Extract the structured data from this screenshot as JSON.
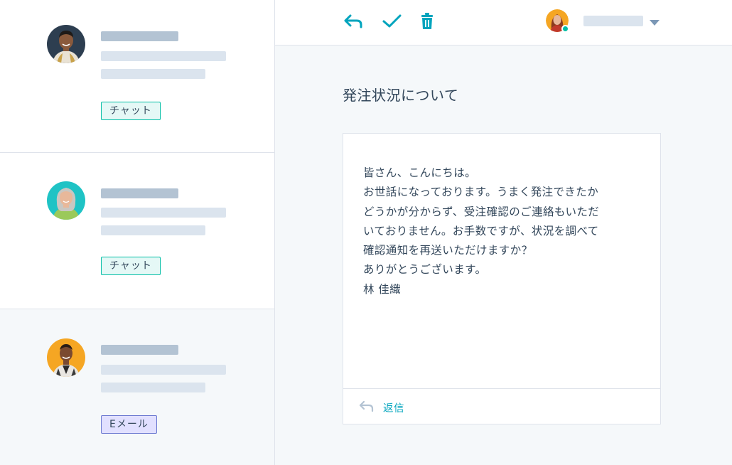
{
  "conversations": [
    {
      "channel_tag": "チャット",
      "channel_type": "chat",
      "avatar_colors": {
        "bg": "#2d3e50",
        "skin": "#8a5a3c",
        "hair": "#1f1a17",
        "shirt": "#e9e2d4"
      }
    },
    {
      "channel_tag": "チャット",
      "channel_type": "chat",
      "avatar_colors": {
        "bg": "#1fc3c5",
        "skin": "#e8b89a",
        "hair": "#c9c7c2",
        "shirt": "#9bc95a"
      }
    },
    {
      "channel_tag": "Eメール",
      "channel_type": "email",
      "avatar_colors": {
        "bg": "#f5a623",
        "skin": "#7a4a30",
        "hair": "#2a1d16",
        "shirt": "#e9e6e1"
      }
    }
  ],
  "toolbar": {
    "icons": [
      "reply-icon",
      "check-icon",
      "trash-icon"
    ],
    "accent": "#00a4bd"
  },
  "owner": {
    "status_color": "#00bda5",
    "icon": "chevron-down-icon"
  },
  "message": {
    "subject": "発注状況について",
    "body_lines": [
      "皆さん、こんにちは。",
      "お世話になっております。うまく発注できたか",
      "どうかが分からず、受注確認のご連絡もいただ",
      "いておりません。お手数ですが、状況を調べて",
      "確認通知を再送いただけますか？",
      "ありがとうございます。",
      "林 佳織"
    ],
    "reply_label": "返信"
  }
}
